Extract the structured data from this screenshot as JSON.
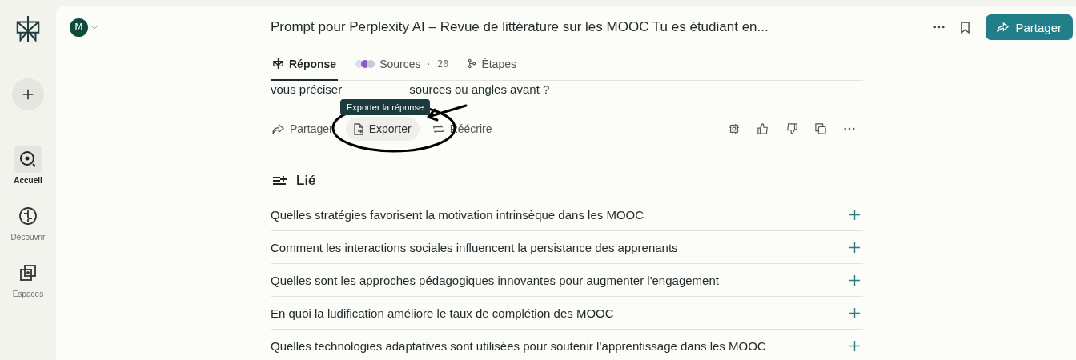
{
  "sidebar": {
    "items": [
      {
        "label": "Accueil",
        "selected": true
      },
      {
        "label": "Découvrir",
        "selected": false
      },
      {
        "label": "Espaces",
        "selected": false
      }
    ]
  },
  "header": {
    "avatar": "M",
    "title": "Prompt pour Perplexity AI – Revue de littérature sur les MOOC Tu es étudiant en...",
    "share_button": "Partager"
  },
  "tabs": [
    {
      "label": "Réponse",
      "selected": true
    },
    {
      "label": "Sources",
      "count": "· 20",
      "selected": false
    },
    {
      "label": "Étapes",
      "selected": false
    }
  ],
  "answer_text": [
    "vous préciser",
    "sources ou angles avant ?"
  ],
  "tooltip": "Exporter la réponse",
  "actions": [
    {
      "label": "Partager",
      "hovered": false
    },
    {
      "label": "Exporter",
      "hovered": true
    },
    {
      "label": "Réécrire",
      "hovered": false
    }
  ],
  "related": {
    "title": "Lié",
    "items": [
      "Quelles stratégies favorisent la motivation intrinsèque dans les MOOC",
      "Comment les interactions sociales influencent la persistance des apprenants",
      "Quelles sont les approches pédagogiques innovantes pour augmenter l'engagement",
      "En quoi la ludification améliore le taux de complétion des MOOC",
      "Quelles technologies adaptatives sont utilisées pour soutenir l’apprentissage dans les MOOC"
    ]
  }
}
